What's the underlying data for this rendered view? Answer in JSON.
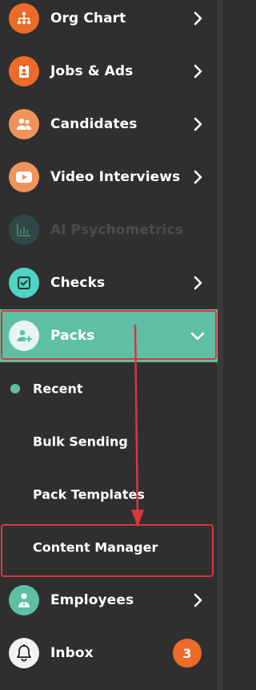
{
  "nav": {
    "org_chart": "Org Chart",
    "jobs_ads": "Jobs & Ads",
    "candidates": "Candidates",
    "video_interviews": "Video Interviews",
    "ai_psychometrics": "AI Psychometrics",
    "checks": "Checks",
    "packs": "Packs",
    "employees": "Employees",
    "inbox": "Inbox"
  },
  "packs_submenu": {
    "recent": "Recent",
    "bulk_sending": "Bulk Sending",
    "pack_templates": "Pack Templates",
    "content_manager": "Content Manager"
  },
  "inbox_badge": "3",
  "colors": {
    "sidebar_bg": "#2f2f2f",
    "accent_orange": "#ec6b28",
    "accent_teal": "#5fbfa5",
    "check_icon_bg": "#4fd3c4",
    "annotation_red": "#d9363e"
  },
  "icons": {
    "org_chart": "org-chart-icon",
    "jobs_ads": "badge-icon",
    "candidates": "people-icon",
    "video_interviews": "play-icon",
    "ai_psychometrics": "bar-chart-icon",
    "checks": "checkbox-icon",
    "packs": "add-user-icon",
    "employees": "employee-icon",
    "inbox": "bell-icon"
  }
}
